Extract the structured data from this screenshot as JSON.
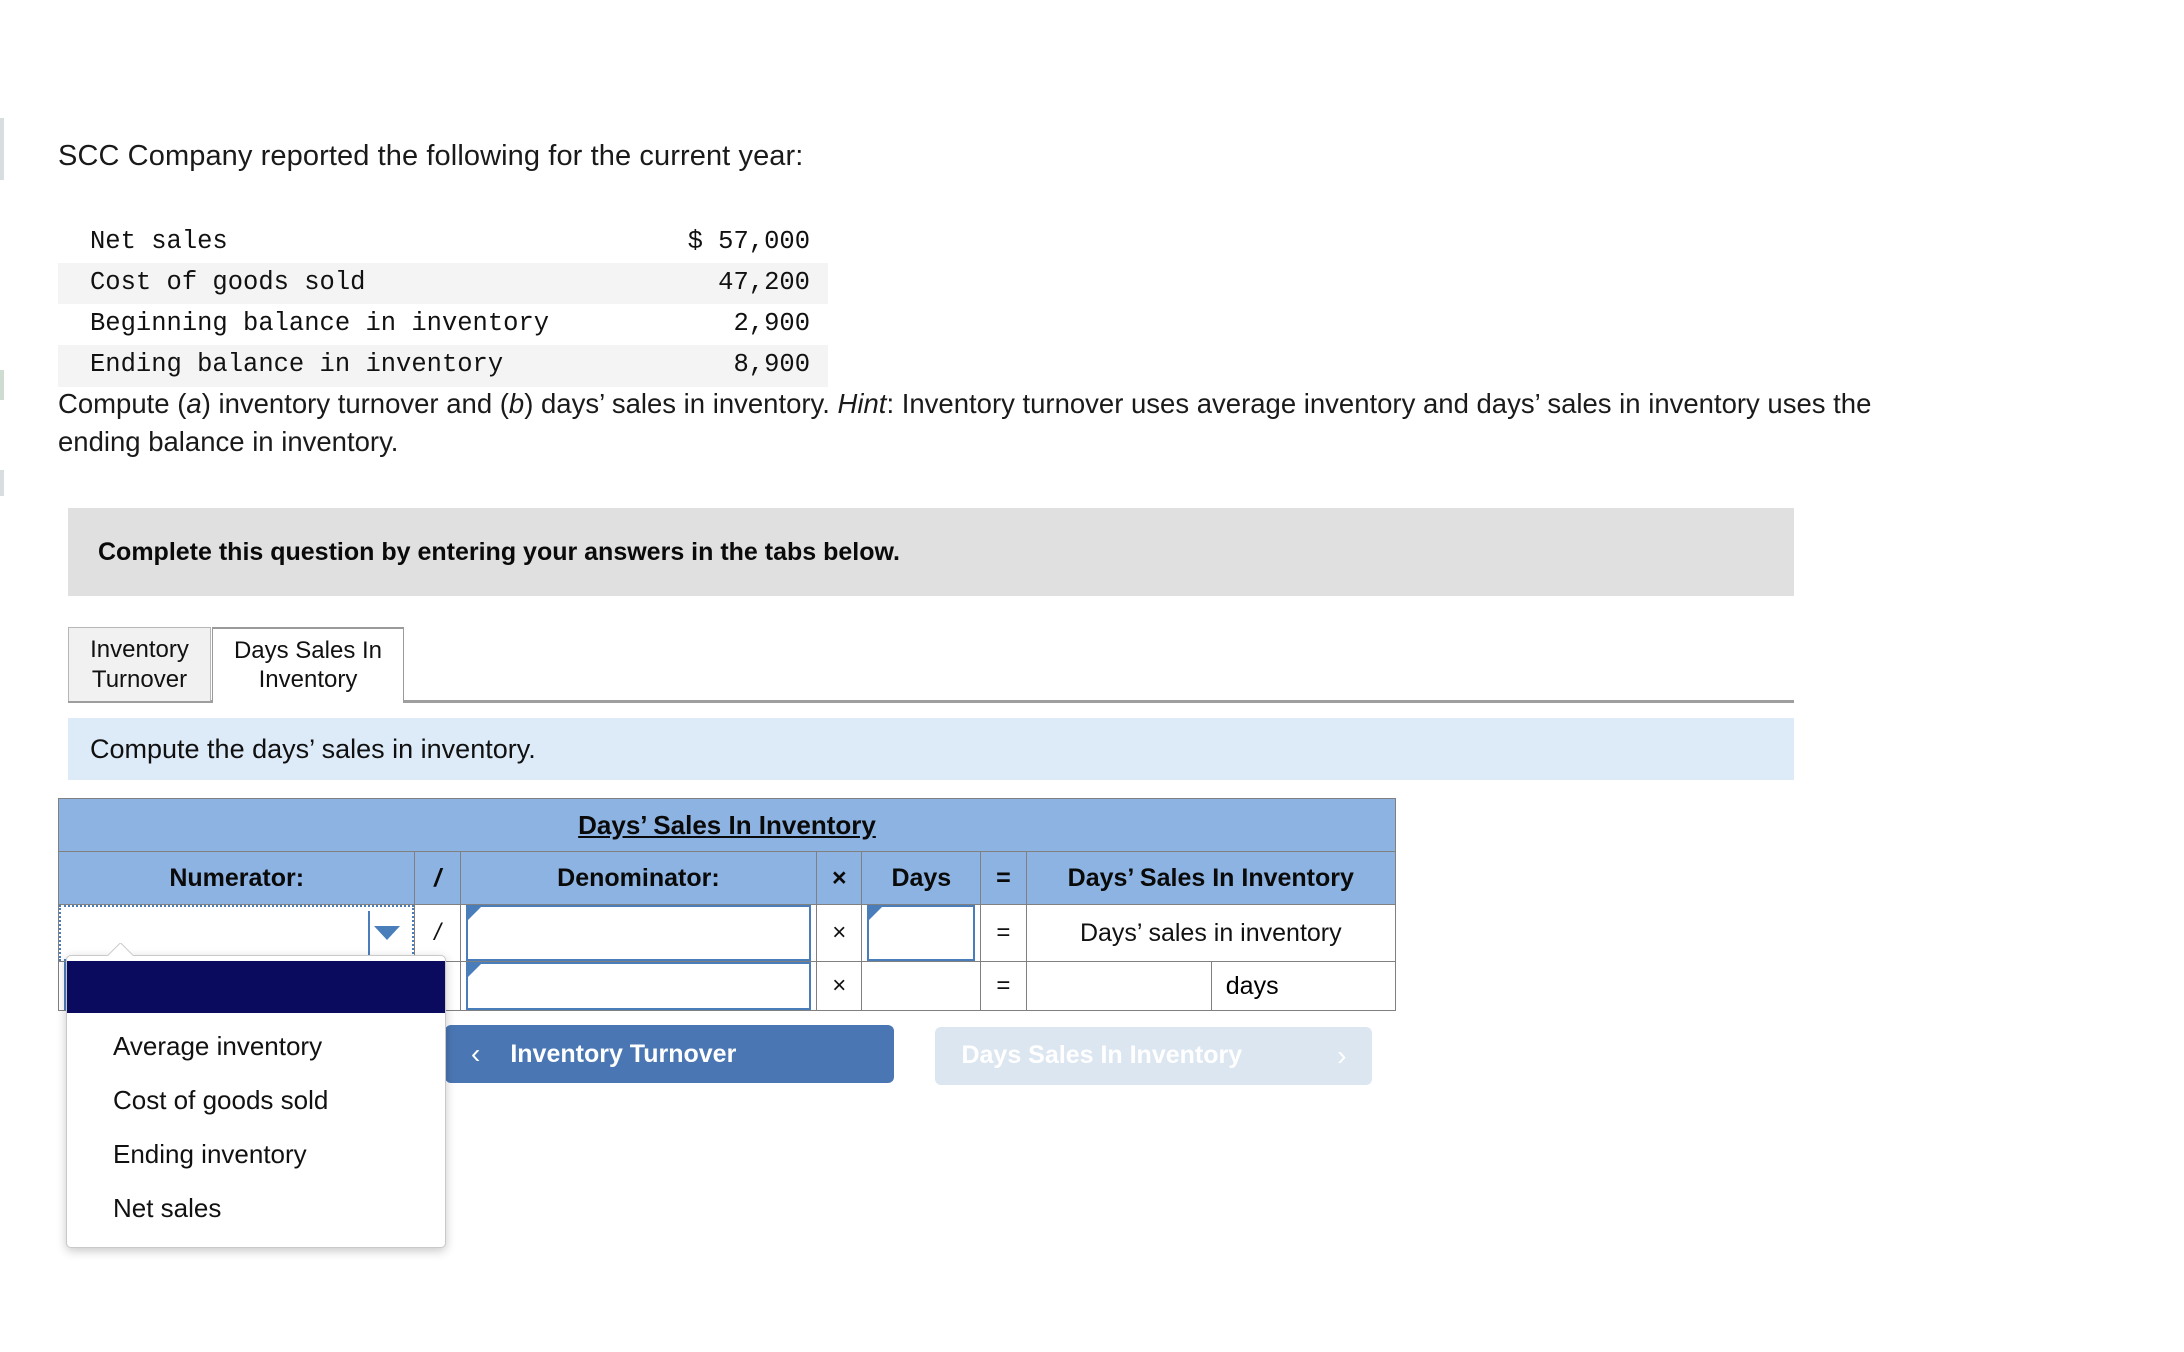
{
  "intro": "SCC Company reported the following for the current year:",
  "figures": {
    "rows": [
      {
        "label": "Net sales",
        "value": "$ 57,000"
      },
      {
        "label": "Cost of goods sold",
        "value": "47,200"
      },
      {
        "label": "Beginning balance in inventory",
        "value": "2,900"
      },
      {
        "label": "Ending balance in inventory",
        "value": "8,900"
      }
    ]
  },
  "compute": {
    "p1": "Compute (",
    "a": "a",
    "p2": ") inventory turnover and (",
    "b": "b",
    "p3": ") days’ sales in inventory. ",
    "hint": "Hint",
    "p4": ": Inventory turnover uses average inventory and days’ sales in inventory uses the ending balance in inventory."
  },
  "notice": {
    "text": "Complete this question by entering your answers in the tabs below."
  },
  "tabs": {
    "items": [
      {
        "label": "Inventory Turnover",
        "active": false
      },
      {
        "label": "Days Sales In Inventory",
        "active": true
      }
    ]
  },
  "prompt": {
    "text": "Compute the days’ sales in inventory."
  },
  "calc": {
    "title": "Days’ Sales In Inventory",
    "headers": {
      "numerator": "Numerator:",
      "divide": "/",
      "denominator": "Denominator:",
      "times": "×",
      "days": "Days",
      "equals": "=",
      "result": "Days’ Sales In Inventory"
    },
    "row1": {
      "numerator_value": "",
      "divide": "/",
      "denominator_value": "",
      "times": "×",
      "days_value": "",
      "equals": "=",
      "result": "Days’ sales in inventory"
    },
    "row2": {
      "numerator_value": "",
      "divide": "/",
      "denominator_value": "",
      "times": "×",
      "days_value": "",
      "equals": "=",
      "result_value": "",
      "result_unit": "days"
    }
  },
  "dropdown": {
    "options": [
      {
        "label": "",
        "selected": true
      },
      {
        "label": "Average inventory",
        "selected": false
      },
      {
        "label": "Cost of goods sold",
        "selected": false
      },
      {
        "label": "Ending inventory",
        "selected": false
      },
      {
        "label": "Net sales",
        "selected": false
      }
    ]
  },
  "nav": {
    "prev": {
      "label": "Inventory Turnover",
      "chevron": "‹"
    },
    "next": {
      "label": "Days Sales In Inventory",
      "chevron": "›"
    }
  },
  "colors": {
    "header_blue": "#8db3e2",
    "prompt_blue": "#ddeaf7",
    "notice_grey": "#e0e0e0",
    "button_blue": "#4a77b4",
    "button_disabled": "#dce6f1",
    "input_border": "#4a7ebb",
    "dropdown_selected": "#0a0a5e"
  }
}
